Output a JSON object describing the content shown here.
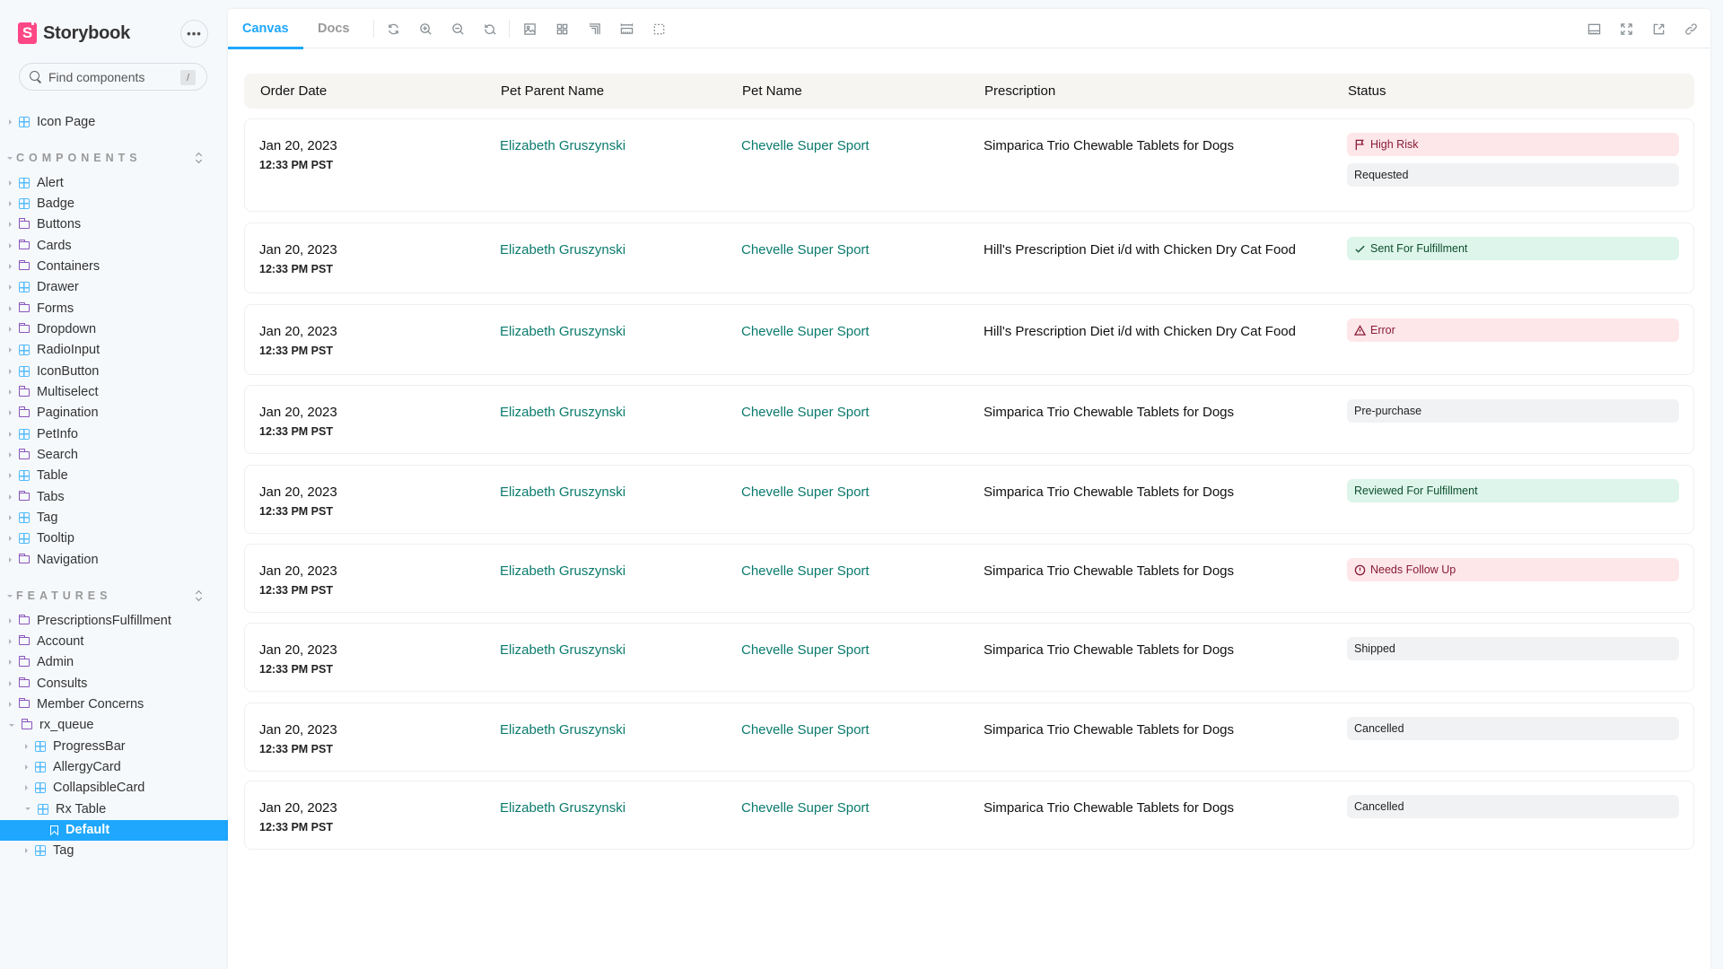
{
  "app": {
    "brand_name": "Storybook",
    "brand_logo_letter": "S",
    "more_icon": "•••",
    "search": {
      "placeholder": "Find components",
      "value": "",
      "shortcut": "/"
    }
  },
  "sidebar": {
    "top_items": [
      {
        "label": "Icon Page",
        "icon": "component-icon"
      }
    ],
    "sections": [
      {
        "title": "COMPONENTS",
        "items": [
          {
            "label": "Alert",
            "icon": "component-icon"
          },
          {
            "label": "Badge",
            "icon": "component-icon"
          },
          {
            "label": "Buttons",
            "icon": "folder-icon"
          },
          {
            "label": "Cards",
            "icon": "folder-icon"
          },
          {
            "label": "Containers",
            "icon": "folder-icon"
          },
          {
            "label": "Drawer",
            "icon": "component-icon"
          },
          {
            "label": "Forms",
            "icon": "folder-icon"
          },
          {
            "label": "Dropdown",
            "icon": "folder-icon"
          },
          {
            "label": "RadioInput",
            "icon": "component-icon"
          },
          {
            "label": "IconButton",
            "icon": "component-icon"
          },
          {
            "label": "Multiselect",
            "icon": "folder-icon"
          },
          {
            "label": "Pagination",
            "icon": "folder-icon"
          },
          {
            "label": "PetInfo",
            "icon": "component-icon"
          },
          {
            "label": "Search",
            "icon": "folder-icon"
          },
          {
            "label": "Table",
            "icon": "component-icon"
          },
          {
            "label": "Tabs",
            "icon": "folder-icon"
          },
          {
            "label": "Tag",
            "icon": "component-icon"
          },
          {
            "label": "Tooltip",
            "icon": "component-icon"
          },
          {
            "label": "Navigation",
            "icon": "folder-icon"
          }
        ]
      },
      {
        "title": "FEATURES",
        "items": [
          {
            "label": "PrescriptionsFulfillment",
            "icon": "folder-icon"
          },
          {
            "label": "Account",
            "icon": "folder-icon"
          },
          {
            "label": "Admin",
            "icon": "folder-icon"
          },
          {
            "label": "Consults",
            "icon": "folder-icon"
          },
          {
            "label": "Member Concerns",
            "icon": "folder-icon"
          },
          {
            "label": "rx_queue",
            "icon": "folder-icon",
            "expanded": true
          },
          {
            "label": "ProgressBar",
            "icon": "component-icon",
            "level": 2
          },
          {
            "label": "AllergyCard",
            "icon": "component-icon",
            "level": 2
          },
          {
            "label": "CollapsibleCard",
            "icon": "component-icon",
            "level": 2
          },
          {
            "label": "Rx Table",
            "icon": "component-icon",
            "level": 2,
            "expanded": true
          },
          {
            "label": "Default",
            "icon": "story-icon",
            "level": 3,
            "selected": true
          },
          {
            "label": "Tag",
            "icon": "component-icon",
            "level": 2
          }
        ]
      }
    ]
  },
  "toolbar": {
    "tabs": [
      {
        "label": "Canvas",
        "active": true
      },
      {
        "label": "Docs",
        "active": false
      }
    ],
    "left_tools": [
      "reload-icon",
      "zoom-in-icon",
      "zoom-out-icon",
      "zoom-reset-icon",
      "background-icon",
      "grid-icon",
      "outline-icon",
      "measure-icon",
      "viewport-icon"
    ],
    "right_tools": [
      "addons-panel-icon",
      "fullscreen-icon",
      "open-new-tab-icon",
      "copy-link-icon"
    ]
  },
  "table": {
    "headers": [
      "Order Date",
      "Pet Parent Name",
      "Pet Name",
      "Prescription",
      "Status"
    ],
    "rows": [
      {
        "date": "Jan 20, 2023",
        "time": "12:33 PM PST",
        "parent": "Elizabeth Gruszynski",
        "pet": "Chevelle Super Sport",
        "prescription": "Simparica Trio Chewable Tablets for Dogs",
        "badges": [
          {
            "label": "High Risk",
            "variant": "danger",
            "icon": "flag-icon"
          },
          {
            "label": "Requested",
            "variant": "neutral",
            "icon": ""
          }
        ]
      },
      {
        "date": "Jan 20, 2023",
        "time": "12:33 PM PST",
        "parent": "Elizabeth Gruszynski",
        "pet": "Chevelle Super Sport",
        "prescription": "Hill's Prescription Diet i/d with Chicken Dry Cat Food",
        "badges": [
          {
            "label": "Sent For Fulfillment",
            "variant": "success",
            "icon": "check-icon"
          }
        ]
      },
      {
        "date": "Jan 20, 2023",
        "time": "12:33 PM PST",
        "parent": "Elizabeth Gruszynski",
        "pet": "Chevelle Super Sport",
        "prescription": "Hill's Prescription Diet i/d with Chicken Dry Cat Food",
        "badges": [
          {
            "label": "Error",
            "variant": "danger",
            "icon": "warning-icon"
          }
        ]
      },
      {
        "date": "Jan 20, 2023",
        "time": "12:33 PM PST",
        "parent": "Elizabeth Gruszynski",
        "pet": "Chevelle Super Sport",
        "prescription": "Simparica Trio Chewable Tablets for Dogs",
        "badges": [
          {
            "label": "Pre-purchase",
            "variant": "neutral",
            "icon": ""
          }
        ]
      },
      {
        "date": "Jan 20, 2023",
        "time": "12:33 PM PST",
        "parent": "Elizabeth Gruszynski",
        "pet": "Chevelle Super Sport",
        "prescription": "Simparica Trio Chewable Tablets for Dogs",
        "badges": [
          {
            "label": "Reviewed For Fulfillment",
            "variant": "success",
            "icon": ""
          }
        ]
      },
      {
        "date": "Jan 20, 2023",
        "time": "12:33 PM PST",
        "parent": "Elizabeth Gruszynski",
        "pet": "Chevelle Super Sport",
        "prescription": "Simparica Trio Chewable Tablets for Dogs",
        "badges": [
          {
            "label": "Needs Follow Up",
            "variant": "danger",
            "icon": "alert-circle-icon"
          }
        ]
      },
      {
        "date": "Jan 20, 2023",
        "time": "12:33 PM PST",
        "parent": "Elizabeth Gruszynski",
        "pet": "Chevelle Super Sport",
        "prescription": "Simparica Trio Chewable Tablets for Dogs",
        "badges": [
          {
            "label": "Shipped",
            "variant": "neutral",
            "icon": ""
          }
        ]
      },
      {
        "date": "Jan 20, 2023",
        "time": "12:33 PM PST",
        "parent": "Elizabeth Gruszynski",
        "pet": "Chevelle Super Sport",
        "prescription": "Simparica Trio Chewable Tablets for Dogs",
        "badges": [
          {
            "label": "Cancelled",
            "variant": "neutral",
            "icon": ""
          }
        ]
      },
      {
        "date": "Jan 20, 2023",
        "time": "12:33 PM PST",
        "parent": "Elizabeth Gruszynski",
        "pet": "Chevelle Super Sport",
        "prescription": "Simparica Trio Chewable Tablets for Dogs",
        "badges": [
          {
            "label": "Cancelled",
            "variant": "neutral",
            "icon": ""
          }
        ]
      }
    ]
  },
  "colors": {
    "accent": "#1EA7FD",
    "brand": "#FF4785",
    "link": "#0A7A6C",
    "danger_bg": "#FDE7E9",
    "success_bg": "#DDF5EA",
    "neutral_bg": "#F1F2F4"
  }
}
